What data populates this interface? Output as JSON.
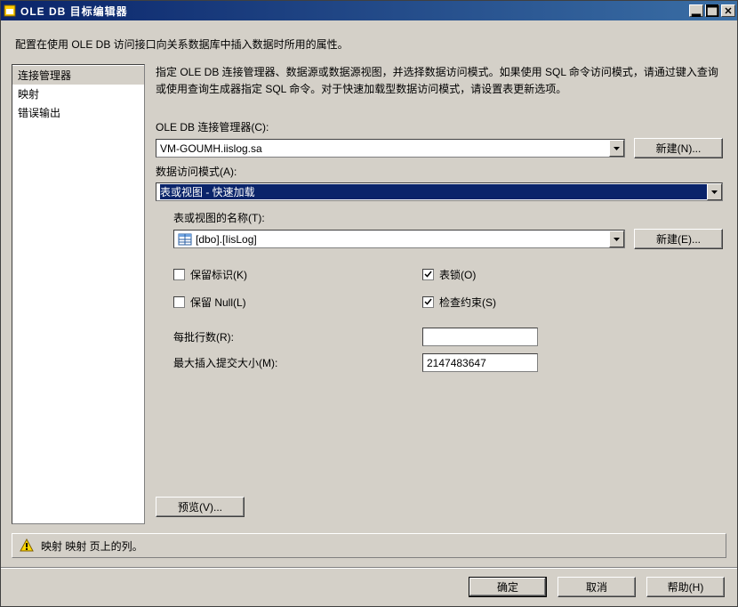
{
  "window": {
    "title": "OLE DB 目标编辑器"
  },
  "description": "配置在使用 OLE DB 访问接口向关系数据库中插入数据时所用的属性。",
  "sidebar": {
    "items": [
      {
        "label": "连接管理器",
        "selected": true
      },
      {
        "label": "映射",
        "selected": false
      },
      {
        "label": "错误输出",
        "selected": false
      }
    ]
  },
  "content": {
    "instruction": "指定 OLE DB 连接管理器、数据源或数据源视图，并选择数据访问模式。如果使用 SQL 命令访问模式，请通过键入查询或使用查询生成器指定 SQL 命令。对于快速加载型数据访问模式，请设置表更新选项。",
    "connection_manager_label": "OLE DB 连接管理器(C):",
    "connection_manager_value": "VM-GOUMH.iislog.sa",
    "new_button_n": "新建(N)...",
    "access_mode_label": "数据访问模式(A):",
    "access_mode_value": "表或视图 - 快速加载",
    "table_name_label": "表或视图的名称(T):",
    "table_name_value": "[dbo].[IisLog]",
    "new_button_e": "新建(E)...",
    "options": {
      "keep_identity": {
        "label": "保留标识(K)",
        "checked": false
      },
      "table_lock": {
        "label": "表锁(O)",
        "checked": true
      },
      "keep_null": {
        "label": "保留 Null(L)",
        "checked": false
      },
      "check_constraints": {
        "label": "检查约束(S)",
        "checked": true
      },
      "rows_per_batch_label": "每批行数(R):",
      "rows_per_batch_value": "",
      "max_insert_commit_label": "最大插入提交大小(M):",
      "max_insert_commit_value": "2147483647"
    },
    "preview_button": "预览(V)..."
  },
  "status": {
    "message": "映射 映射 页上的列。"
  },
  "buttons": {
    "ok": "确定",
    "cancel": "取消",
    "help": "帮助(H)"
  }
}
